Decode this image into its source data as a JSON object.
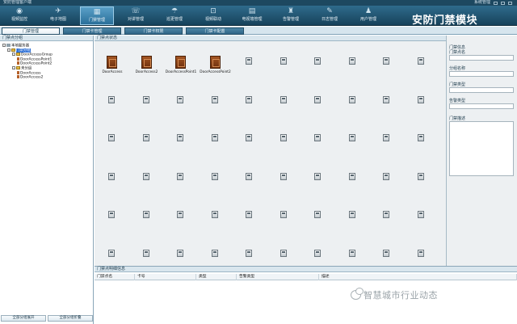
{
  "window": {
    "title": "安防管理客户端",
    "right_text": "系统管理"
  },
  "toolbar": {
    "items": [
      {
        "label": "视频监控",
        "icon": "camera-icon"
      },
      {
        "label": "电子地图",
        "icon": "map-icon"
      },
      {
        "label": "门禁管理",
        "icon": "door-access-icon"
      },
      {
        "label": "对讲管理",
        "icon": "intercom-icon"
      },
      {
        "label": "巡更管理",
        "icon": "patrol-icon"
      },
      {
        "label": "视频联动",
        "icon": "video-link-icon"
      },
      {
        "label": "电视墙管理",
        "icon": "tv-wall-icon"
      },
      {
        "label": "告警管理",
        "icon": "alarm-icon"
      },
      {
        "label": "日志管理",
        "icon": "log-icon"
      },
      {
        "label": "用户管理",
        "icon": "user-icon"
      }
    ],
    "active_index": 2
  },
  "brand": "安防门禁模块",
  "tabs": [
    "门禁管理",
    "门禁卡管理",
    "门禁卡权限",
    "门禁卡配置"
  ],
  "left_panel": {
    "header": "门禁点分组",
    "tree": [
      {
        "label": "本地服务器",
        "level": 0,
        "type": "host",
        "toggle": "-"
      },
      {
        "label": "门禁分组",
        "level": 1,
        "type": "folder",
        "toggle": "-",
        "selected": true
      },
      {
        "label": "DoorAccessGroup",
        "level": 2,
        "type": "folder",
        "toggle": "-"
      },
      {
        "label": "DoorAccessPoint1",
        "level": 3,
        "type": "door"
      },
      {
        "label": "DoorAccessPoint2",
        "level": 3,
        "type": "door"
      },
      {
        "label": "未分组",
        "level": 2,
        "type": "folder",
        "toggle": "-"
      },
      {
        "label": "DoorAccess",
        "level": 3,
        "type": "door"
      },
      {
        "label": "DoorAccess2",
        "level": 3,
        "type": "door"
      }
    ],
    "buttons": [
      "全部分组展开",
      "全部分组折叠"
    ]
  },
  "center_panel": {
    "header": "门禁点状态",
    "doors": [
      "DoorAccess",
      "DoorAccess2",
      "DoorAccessPoint1",
      "DoorAccessPoint2"
    ],
    "columns": 10,
    "rows": 6
  },
  "right_panel": {
    "title": "门禁信息",
    "fields": [
      {
        "label": "门禁点名",
        "value": ""
      },
      {
        "label": "分组名称",
        "value": ""
      },
      {
        "label": "门禁类型",
        "value": ""
      },
      {
        "label": "告警类型",
        "value": ""
      },
      {
        "label": "门禁描述",
        "value": ""
      }
    ]
  },
  "bottom_panel": {
    "header": "门禁点明细信息",
    "columns": [
      "门禁点名",
      "卡号",
      "类型",
      "告警类型",
      "描述"
    ]
  },
  "watermark": {
    "text": "智慧城市行业动态",
    "icon": "wechat-icon"
  }
}
